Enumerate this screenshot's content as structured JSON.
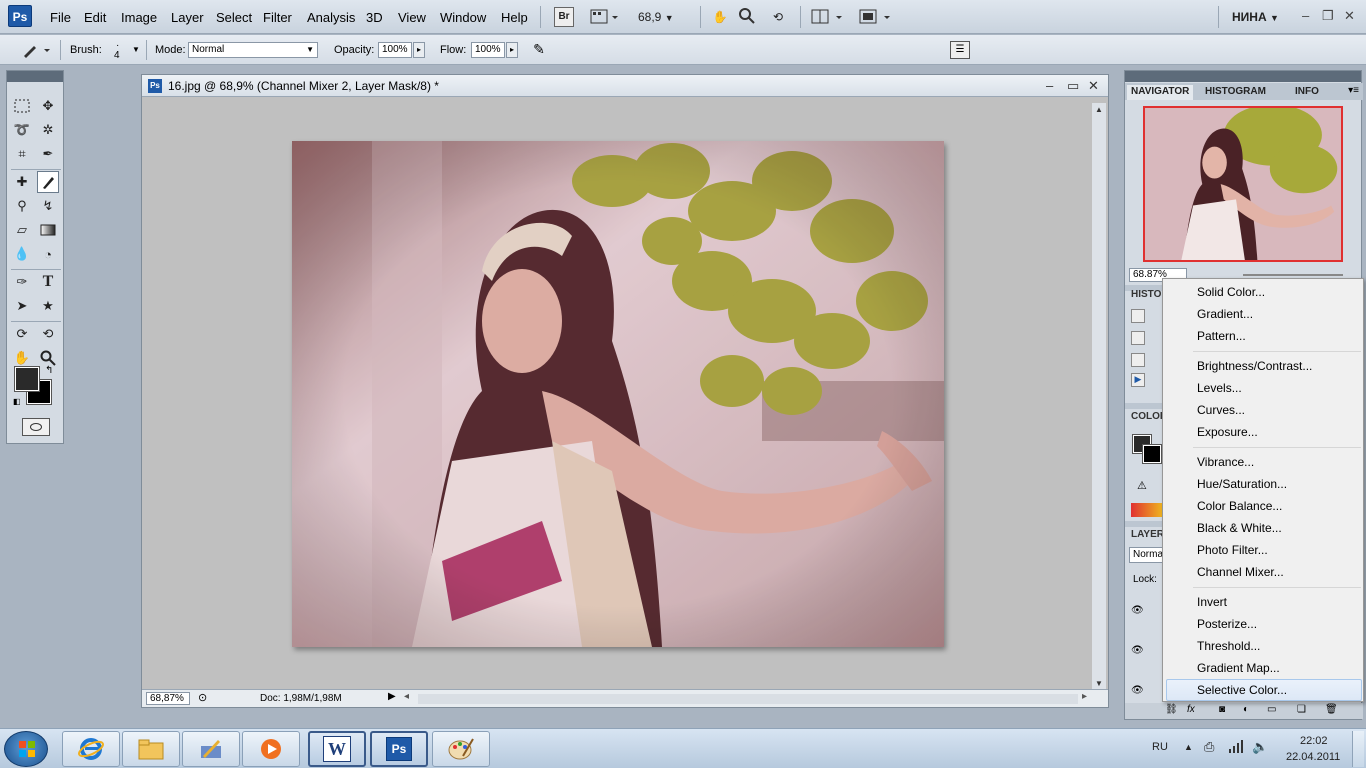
{
  "menubar": {
    "items": [
      "File",
      "Edit",
      "Image",
      "Layer",
      "Select",
      "Filter",
      "Analysis",
      "3D",
      "View",
      "Window",
      "Help"
    ],
    "bridge_label": "Br",
    "zoom_value": "68,9",
    "workspace_name": "НИНА"
  },
  "options": {
    "brush_label": "Brush:",
    "brush_size": "4",
    "mode_label": "Mode:",
    "mode_value": "Normal",
    "opacity_label": "Opacity:",
    "opacity_value": "100%",
    "flow_label": "Flow:",
    "flow_value": "100%"
  },
  "document": {
    "title": "16.jpg @ 68,9% (Channel Mixer 2, Layer Mask/8) *",
    "status_zoom": "68,87%",
    "status_doc": "Doc: 1,98M/1,98M"
  },
  "panels": {
    "navigator_tabs": [
      "NAVIGATOR",
      "HISTOGRAM",
      "INFO"
    ],
    "navigator_zoom": "68.87%",
    "history_label": "HISTO",
    "color_label": "COLOR",
    "layers_label": "LAYER",
    "blend_mode": "Norma",
    "lock_label": "Lock:"
  },
  "context_menu": {
    "groups": [
      [
        "Solid Color...",
        "Gradient...",
        "Pattern..."
      ],
      [
        "Brightness/Contrast...",
        "Levels...",
        "Curves...",
        "Exposure..."
      ],
      [
        "Vibrance...",
        "Hue/Saturation...",
        "Color Balance...",
        "Black & White...",
        "Photo Filter...",
        "Channel Mixer..."
      ],
      [
        "Invert",
        "Posterize...",
        "Threshold...",
        "Gradient Map...",
        "Selective Color..."
      ]
    ],
    "highlighted": "Selective Color..."
  },
  "taskbar": {
    "language": "RU",
    "time": "22:02",
    "date": "22.04.2011",
    "word_label": "W",
    "ps_label": "Ps"
  }
}
